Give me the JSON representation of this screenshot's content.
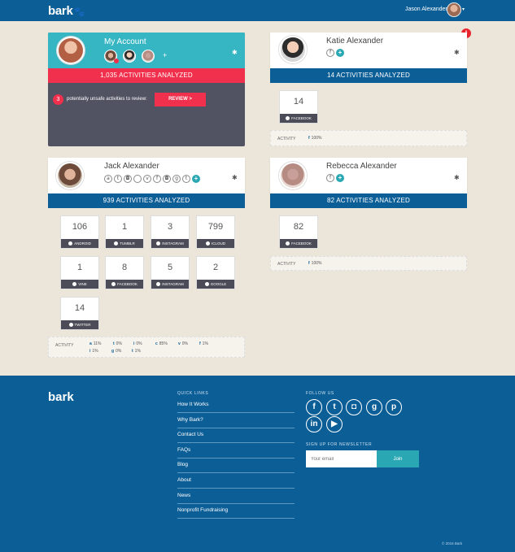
{
  "header": {
    "logo": "bark",
    "user_name": "Jason Alexander"
  },
  "my_account": {
    "title": "My Account",
    "activities": "1,035 ACTIVITIES ANALYZED",
    "unsafe_count": "3",
    "unsafe_text": "potentially unsafe activities to review:",
    "review_label": "REVIEW >"
  },
  "katie": {
    "name": "Katie Alexander",
    "activities": "14 ACTIVITIES ANALYZED",
    "tiles": [
      {
        "value": "14",
        "label": "FACEBOOK"
      }
    ],
    "activity_label": "ACTIVITY",
    "activity_items": [
      {
        "icon": "f",
        "text": "100%"
      }
    ]
  },
  "jack": {
    "name": "Jack Alexander",
    "activities": "939 ACTIVITIES ANALYZED",
    "tiles": [
      {
        "value": "106",
        "label": "ANDROID"
      },
      {
        "value": "1",
        "label": "TUMBLR"
      },
      {
        "value": "3",
        "label": "INSTAGRAM"
      },
      {
        "value": "799",
        "label": "ICLOUD"
      },
      {
        "value": "1",
        "label": "VINE"
      },
      {
        "value": "8",
        "label": "FACEBOOK"
      },
      {
        "value": "5",
        "label": "INSTAGRAM"
      },
      {
        "value": "2",
        "label": "GOOGLE"
      },
      {
        "value": "14",
        "label": "TWITTER"
      }
    ],
    "activity_label": "ACTIVITY",
    "activity_items": [
      {
        "icon": "a",
        "text": "11%"
      },
      {
        "icon": "t",
        "text": "0%"
      },
      {
        "icon": "i",
        "text": "0%"
      },
      {
        "icon": "c",
        "text": "85%"
      },
      {
        "icon": "v",
        "text": "0%"
      },
      {
        "icon": "f",
        "text": "1%"
      },
      {
        "icon": "i",
        "text": "1%"
      },
      {
        "icon": "g",
        "text": "0%"
      },
      {
        "icon": "t",
        "text": "1%"
      }
    ]
  },
  "rebecca": {
    "name": "Rebecca Alexander",
    "activities": "82 ACTIVITIES ANALYZED",
    "tiles": [
      {
        "value": "82",
        "label": "FACEBOOK"
      }
    ],
    "activity_label": "ACTIVITY",
    "activity_items": [
      {
        "icon": "f",
        "text": "100%"
      }
    ]
  },
  "footer": {
    "logo": "bark",
    "quick_links_heading": "QUICK LINKS",
    "links": [
      "How It Works",
      "Why Bark?",
      "Contact Us",
      "FAQs",
      "Blog",
      "About",
      "News",
      "Nonprofit Fundraising"
    ],
    "follow_heading": "FOLLOW US",
    "newsletter_heading": "SIGN UP FOR NEWSLETTER",
    "email_placeholder": "Your email",
    "join_label": "Join",
    "copyright": "© 2016 Bark"
  },
  "colors": {
    "brand_blue": "#0c5e97",
    "teal": "#36b6c3",
    "alert_red": "#f0304c",
    "background": "#ece6da"
  }
}
